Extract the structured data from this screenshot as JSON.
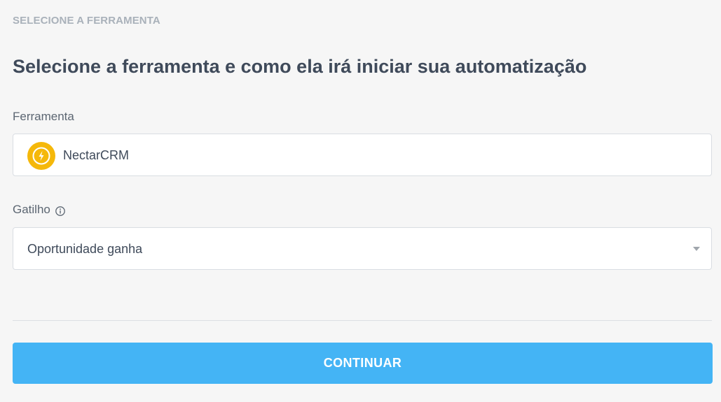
{
  "header": {
    "step_label": "SELECIONE A FERRAMENTA",
    "title": "Selecione a ferramenta e como ela irá iniciar sua automatização"
  },
  "tool_field": {
    "label": "Ferramenta",
    "value": "NectarCRM",
    "icon": "nectarcrm-logo-icon",
    "icon_color": "#f5b80a"
  },
  "trigger_field": {
    "label": "Gatilho",
    "info_icon": "info-icon",
    "selected_value": "Oportunidade ganha"
  },
  "actions": {
    "continue_label": "CONTINUAR",
    "button_color": "#44b4f5"
  }
}
